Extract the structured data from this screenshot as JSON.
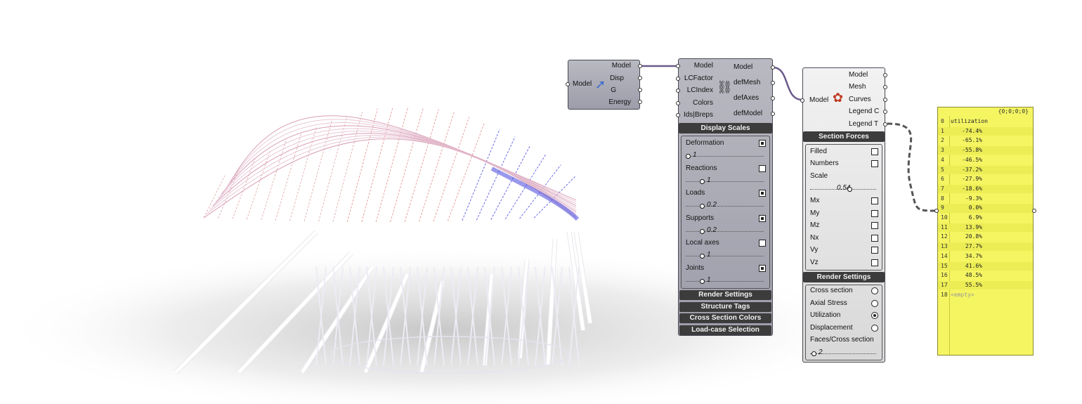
{
  "model_component": {
    "input": "Model",
    "outputs": [
      "Model",
      "Disp",
      "G",
      "Energy"
    ]
  },
  "modelview_component": {
    "inputs": [
      "Model",
      "LCFactor",
      "LCIndex",
      "Colors",
      "Ids|Breps"
    ],
    "outputs": [
      "Model",
      "defMesh",
      "defAxes",
      "defModel"
    ],
    "display_scales_header": "Display Scales",
    "display_options": [
      {
        "label": "Deformation",
        "checked": true,
        "value": "1"
      },
      {
        "label": "Reactions",
        "checked": false,
        "value": "1"
      },
      {
        "label": "Loads",
        "checked": true,
        "value": "0.2"
      },
      {
        "label": "Supports",
        "checked": true,
        "value": "0.2"
      },
      {
        "label": "Local axes",
        "checked": false,
        "value": "1"
      },
      {
        "label": "Joints",
        "checked": true,
        "value": "1"
      }
    ],
    "buttons": [
      "Render Settings",
      "Structure Tags",
      "Cross Section Colors",
      "Load-case Selection"
    ]
  },
  "beamview_component": {
    "input": "Model",
    "outputs": [
      "Model",
      "Mesh",
      "Curves",
      "Legend C",
      "Legend T"
    ],
    "section_forces_header": "Section Forces",
    "filled_label": "Filled",
    "filled": false,
    "numbers_label": "Numbers",
    "numbers": false,
    "scale_label": "Scale",
    "scale_value": "0.54",
    "forces": [
      {
        "label": "Mx",
        "checked": false
      },
      {
        "label": "My",
        "checked": false
      },
      {
        "label": "Mz",
        "checked": false
      },
      {
        "label": "Nx",
        "checked": false
      },
      {
        "label": "Vy",
        "checked": false
      },
      {
        "label": "Vz",
        "checked": false
      }
    ],
    "render_settings_header": "Render Settings",
    "render_options": [
      {
        "label": "Cross section",
        "selected": false
      },
      {
        "label": "Axial Stress",
        "selected": false
      },
      {
        "label": "Utilization",
        "selected": true
      },
      {
        "label": "Displacement",
        "selected": false
      }
    ],
    "faces_label": "Faces/Cross section",
    "faces_value": "2"
  },
  "legend_panel": {
    "path": "{0;0;0;0}",
    "rows": [
      {
        "index": "0",
        "value": "utilization"
      },
      {
        "index": "1",
        "value": "-74.4%"
      },
      {
        "index": "2",
        "value": "-65.1%"
      },
      {
        "index": "3",
        "value": "-55.8%"
      },
      {
        "index": "4",
        "value": "-46.5%"
      },
      {
        "index": "5",
        "value": "-37.2%"
      },
      {
        "index": "6",
        "value": "-27.9%"
      },
      {
        "index": "7",
        "value": "-18.6%"
      },
      {
        "index": "8",
        "value": "-9.3%"
      },
      {
        "index": "9",
        "value": "0.0%"
      },
      {
        "index": "10",
        "value": "6.9%"
      },
      {
        "index": "11",
        "value": "13.9%"
      },
      {
        "index": "12",
        "value": "20.8%"
      },
      {
        "index": "13",
        "value": "27.7%"
      },
      {
        "index": "14",
        "value": "34.7%"
      },
      {
        "index": "15",
        "value": "41.6%"
      },
      {
        "index": "16",
        "value": "48.5%"
      },
      {
        "index": "17",
        "value": "55.5%"
      },
      {
        "index": "18",
        "value": "<empty>"
      }
    ]
  },
  "colors": {
    "canvas": "#ffffff",
    "panel_yellow": "#f5f562",
    "header_dark": "#3c3c3c",
    "compression_blue": "#5a5ae6",
    "tension_red": "#e66a6a",
    "wire": "#6a5a8a"
  }
}
